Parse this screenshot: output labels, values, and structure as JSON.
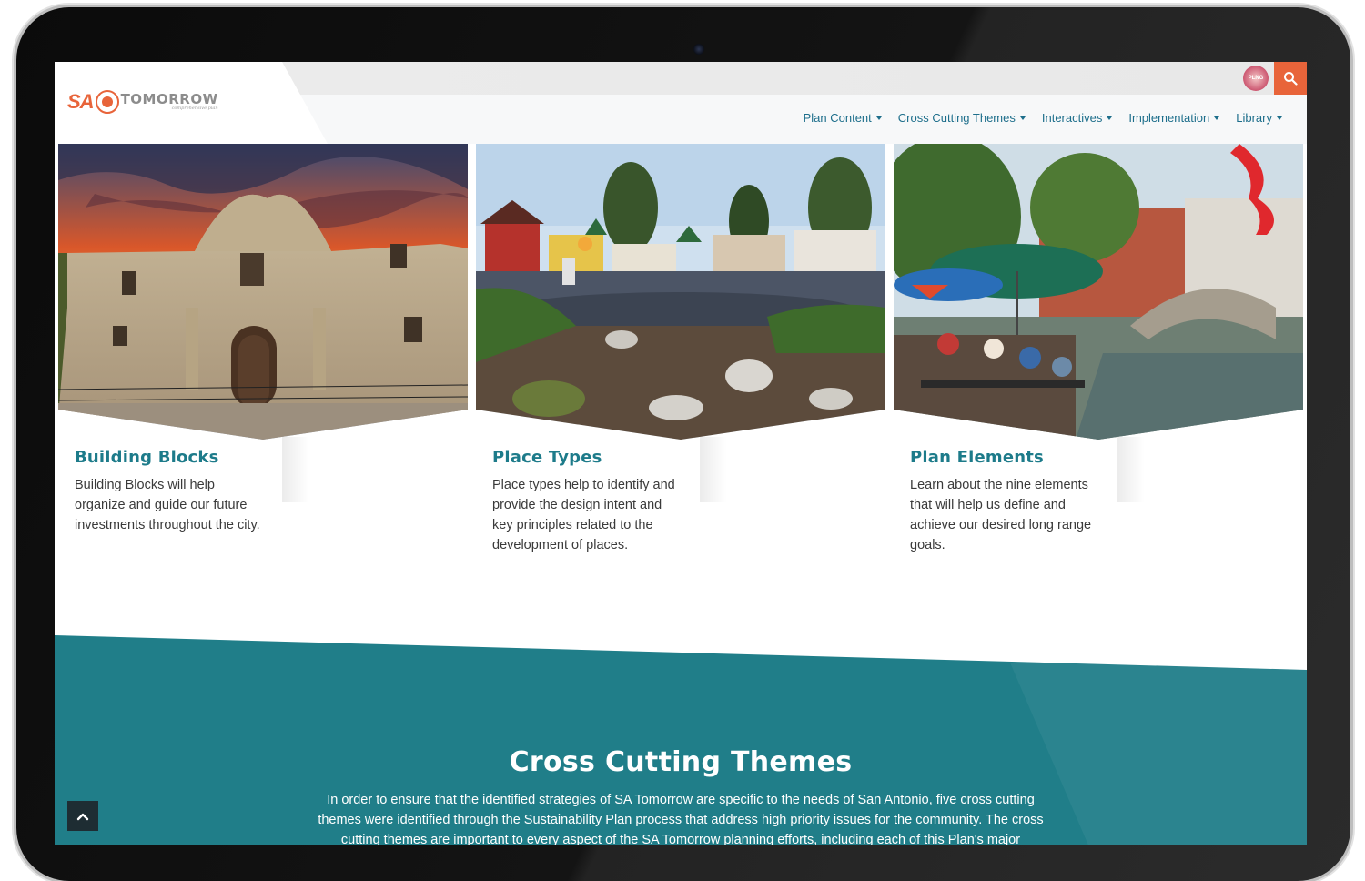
{
  "brand": {
    "logo_prefix": "SA",
    "logo_name": "TOMORROW",
    "logo_tagline": "comprehensive plan",
    "badge_text": "PLNG"
  },
  "colors": {
    "accent_orange": "#e8643a",
    "nav_blue": "#1d6e8b",
    "teal": "#207e89",
    "title_teal": "#1d7b8a"
  },
  "icons": {
    "search": "search-icon",
    "caret": "caret-down-icon",
    "back_to_top": "chevron-up-icon"
  },
  "nav": {
    "items": [
      {
        "label": "Plan Content"
      },
      {
        "label": "Cross Cutting Themes"
      },
      {
        "label": "Interactives"
      },
      {
        "label": "Implementation"
      },
      {
        "label": "Library"
      }
    ]
  },
  "cards": [
    {
      "title": "Building Blocks",
      "description": "Building Blocks will help organize and guide our future investments throughout the city.",
      "image": "alamo-mission-photo"
    },
    {
      "title": "Place Types",
      "description": "Place types help to identify and provide the design intent and key principles related to the development of places.",
      "image": "playground-park-photo"
    },
    {
      "title": "Plan Elements",
      "description": "Learn about the nine elements that will help us define and achieve our desired long range goals.",
      "image": "riverwalk-photo"
    }
  ],
  "themes": {
    "title": "Cross Cutting Themes",
    "body": "In order to ensure that the identified strategies of SA Tomorrow are specific to the needs of San Antonio, five cross cutting themes were identified through the Sustainability Plan process that address high priority issues for the community. The cross cutting themes are important to every aspect of the SA Tomorrow planning efforts, including each of this Plan's major"
  }
}
